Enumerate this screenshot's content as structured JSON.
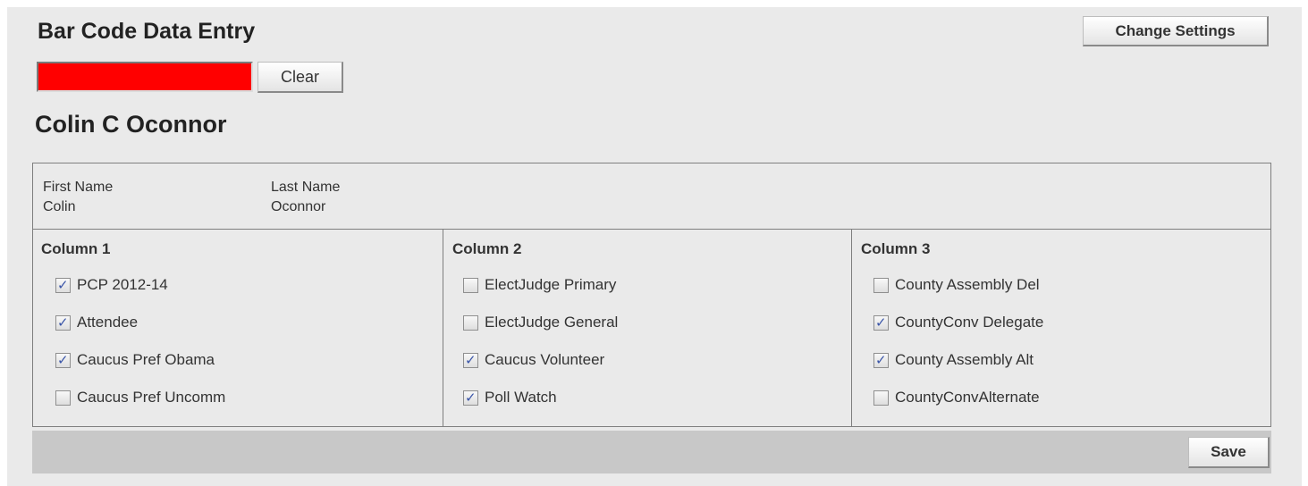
{
  "header": {
    "title": "Bar Code Data Entry",
    "change_settings_label": "Change Settings"
  },
  "barcode": {
    "value": "",
    "background_color": "#ff0000",
    "clear_label": "Clear"
  },
  "person": {
    "full_name": "Colin C Oconnor",
    "first_name_label": "First Name",
    "first_name": "Colin",
    "last_name_label": "Last Name",
    "last_name": "Oconnor"
  },
  "columns": [
    {
      "header": "Column 1",
      "items": [
        {
          "label": "PCP 2012-14",
          "checked": true
        },
        {
          "label": "Attendee",
          "checked": true
        },
        {
          "label": "Caucus Pref Obama",
          "checked": true
        },
        {
          "label": "Caucus Pref Uncomm",
          "checked": false
        }
      ]
    },
    {
      "header": "Column 2",
      "items": [
        {
          "label": "ElectJudge Primary",
          "checked": false
        },
        {
          "label": "ElectJudge General",
          "checked": false
        },
        {
          "label": "Caucus Volunteer",
          "checked": true
        },
        {
          "label": "Poll Watch",
          "checked": true
        }
      ]
    },
    {
      "header": "Column 3",
      "items": [
        {
          "label": "County Assembly Del",
          "checked": false
        },
        {
          "label": "CountyConv Delegate",
          "checked": true
        },
        {
          "label": "County Assembly Alt",
          "checked": true
        },
        {
          "label": "CountyConvAlternate",
          "checked": false
        }
      ]
    }
  ],
  "footer": {
    "save_label": "Save"
  },
  "icons": {
    "check_glyph": "✓"
  }
}
